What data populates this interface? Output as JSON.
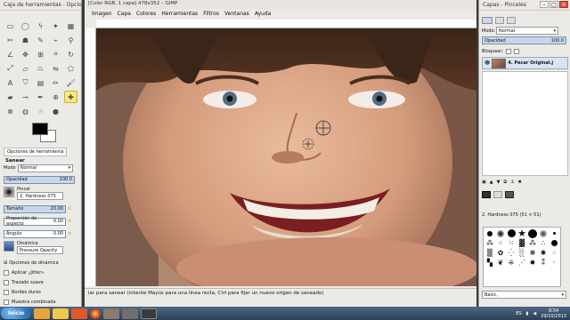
{
  "toolbox": {
    "title": "Caja de herramientas - Opcione...",
    "options_tab": "Opciones de herramienta",
    "tool_name": "Sanear",
    "mode_label": "Modo",
    "mode_value": "Normal",
    "opacity_label": "Opacidad",
    "opacity_value": "100.0",
    "brush_label": "Pincel",
    "brush_value": "2. Hardness 075",
    "size_label": "Tamaño",
    "size_value": "20.00",
    "aspect_label": "Proporción de aspecto",
    "aspect_value": "0.00",
    "angle_label": "Ángulo",
    "angle_value": "0.00",
    "dynamics_label": "Dinámica",
    "dynamics_value": "Pressure Opacity",
    "dynamics_options": "Opciones de dinámica",
    "jitter": "Aplicar ¿jitter»",
    "smooth": "Trazado suave",
    "hard_edges": "Bordes duros",
    "sample_merged": "Muestra combinada"
  },
  "image_window": {
    "title": "[Color RGB, 1 capa] 478x352 – GIMP",
    "menu": [
      "Imagen",
      "Capa",
      "Colores",
      "Herramientas",
      "Filtros",
      "Ventanas",
      "Ayuda"
    ],
    "status": "iar para sanear (intente Mayús para una línea recta, Ctrl para fijar un nuevo origen de saneado)"
  },
  "dock": {
    "title": "Capas - Pinceles",
    "mode_label": "Modo:",
    "mode_value": "Normal",
    "opacity_label": "Opacidad",
    "opacity_value": "100.0",
    "lock_label": "Bloquear:",
    "layer_name": "4. Pecar Original.j",
    "brush_caption": "2. Hardness 075 (51 × 51)",
    "brush_tag": "Basic,"
  },
  "taskbar": {
    "start_label": "Inicio",
    "language": "ES",
    "time": "8:54",
    "date": "29/10/2013"
  },
  "colors": {
    "accent_yellow": "#f7e77a",
    "slider_blue": "#c7d7ea",
    "taskbar": "#2c3f56"
  }
}
